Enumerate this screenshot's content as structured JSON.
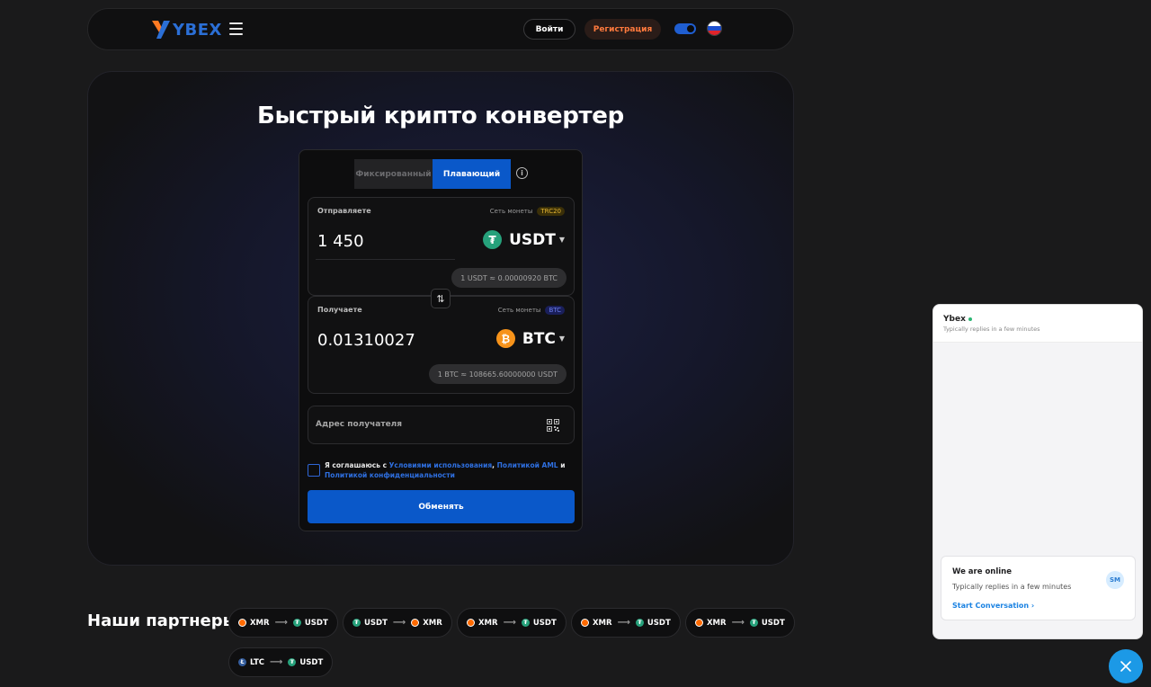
{
  "header": {
    "logo_text": "YBEX",
    "login_label": "Войти",
    "register_label": "Регистрация",
    "theme_toggle": "dark",
    "language_flag": "russia-flag"
  },
  "hero": {
    "title": "Быстрый крипто конвертер"
  },
  "converter": {
    "tabs": [
      {
        "label": "Фиксированный",
        "active": false
      },
      {
        "label": "Плавающий",
        "active": true
      }
    ],
    "send": {
      "label": "Отправляете",
      "network_label": "Сеть монеты",
      "network": "TRC20",
      "amount": "1 450",
      "coin": "USDT",
      "rate": "1 USDT ≈ 0.00000920 BTC"
    },
    "receive": {
      "label": "Получаете",
      "network_label": "Сеть монеты",
      "network": "BTC",
      "amount": "0.01310027",
      "coin": "BTC",
      "rate": "1 BTC ≈ 108665.60000000 USDT"
    },
    "address_placeholder": "Адрес получателя",
    "agree": {
      "prefix": "Я соглашаюсь с ",
      "terms": "Условиями использования",
      "comma": ", ",
      "aml": "Политикой AML",
      "and": " и ",
      "privacy": "Политикой конфиденциальности"
    },
    "exchange_label": "Обменять"
  },
  "partners": {
    "title": "Наши партнеры:",
    "pairs": [
      {
        "from": "XMR",
        "to": "USDT"
      },
      {
        "from": "USDT",
        "to": "XMR"
      },
      {
        "from": "XMR",
        "to": "USDT"
      },
      {
        "from": "XMR",
        "to": "USDT"
      },
      {
        "from": "XMR",
        "to": "USDT"
      },
      {
        "from": "LTC",
        "to": "USDT"
      }
    ]
  },
  "chat": {
    "name": "Ybex",
    "subtitle": "Typically replies in a few minutes",
    "card_title": "We are online",
    "card_sub": "Typically replies in a few minutes",
    "start_label": "Start Conversation",
    "avatar": "SM"
  },
  "colors": {
    "accent": "#0a58c9",
    "register": "#ff7a3d",
    "chat_button": "#1c99e6"
  }
}
